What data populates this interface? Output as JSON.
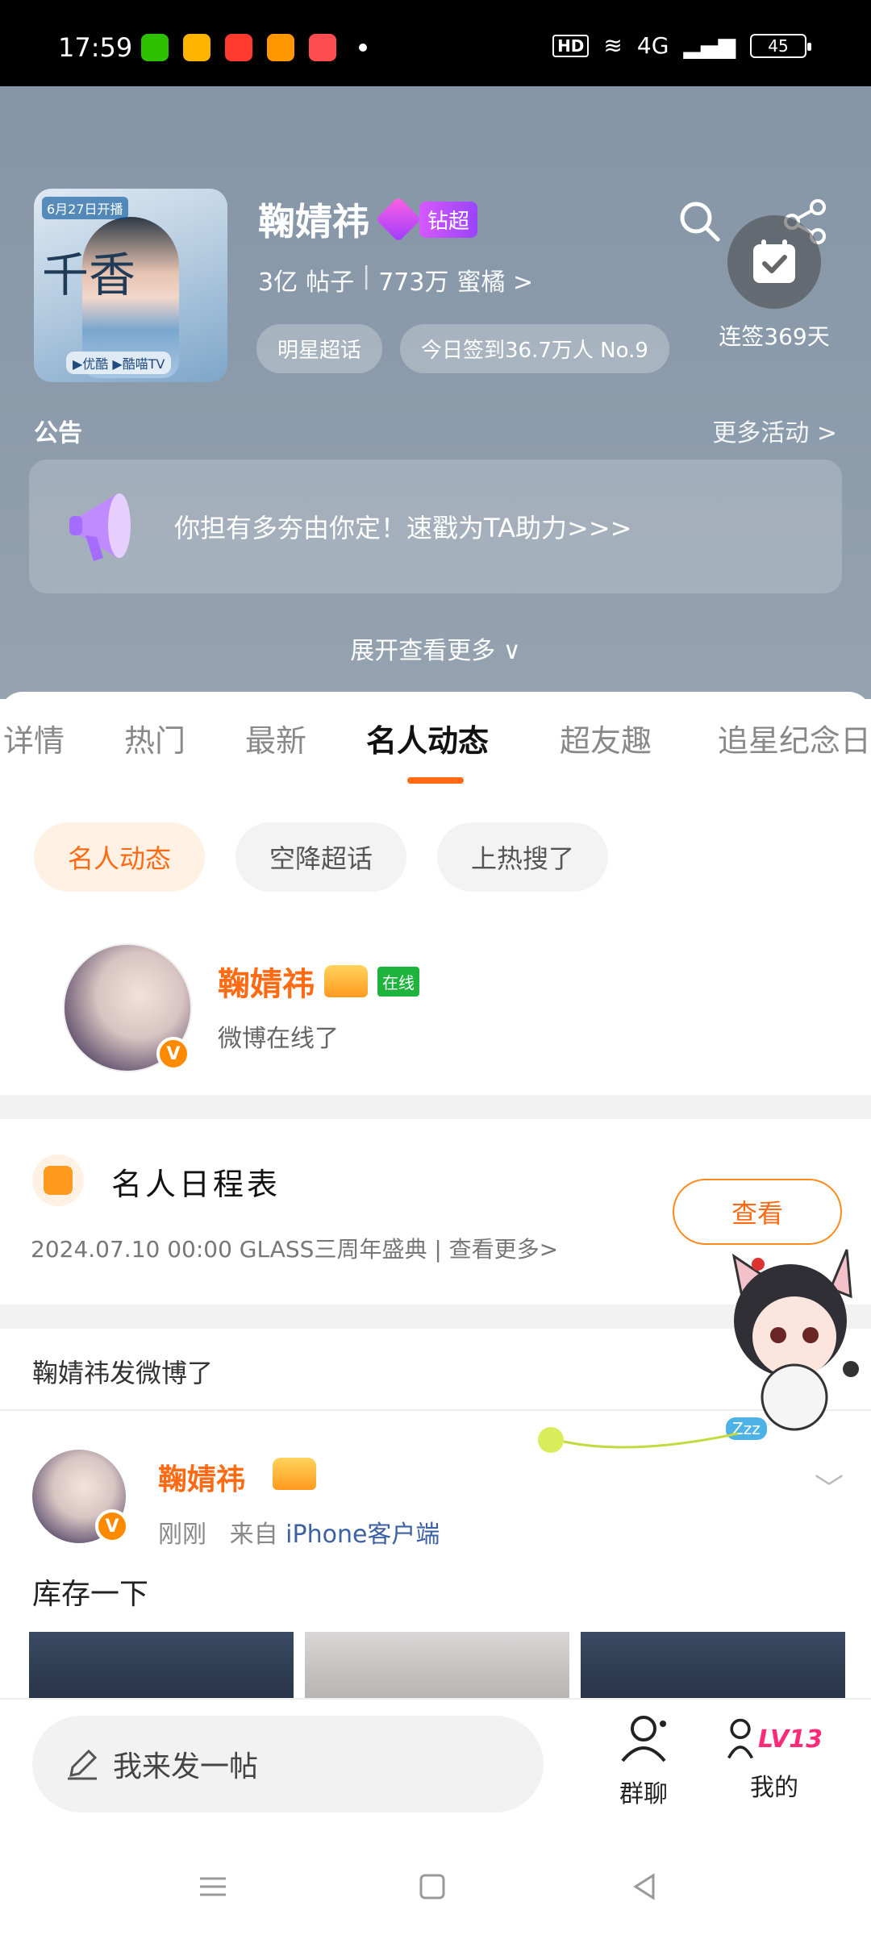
{
  "status_bar": {
    "time": "17:59",
    "hd": "HD",
    "network": "4G",
    "battery": "45"
  },
  "header": {
    "cover": {
      "label": "6月27日开播",
      "big_char": "千香",
      "brand": "▶优酷 ▶酷喵TV"
    },
    "title": "鞠婧祎",
    "super_badge": "钻超",
    "stats": {
      "posts": "3亿",
      "posts_label": "帖子",
      "followers": "773万",
      "followers_label": "蜜橘 >"
    },
    "tags": [
      "明星超话",
      "今日签到36.7万人 No.9"
    ],
    "signin_label": "连签369天",
    "notice_title": "公告",
    "notice_more": "更多活动 >",
    "notice_text": "你担有多夯由你定！速戳为TA助力>>>",
    "expand": "展开查看更多 ∨"
  },
  "tabs": [
    {
      "label": "详情",
      "active": false
    },
    {
      "label": "热门",
      "active": false
    },
    {
      "label": "最新",
      "active": false
    },
    {
      "label": "名人动态",
      "active": true
    },
    {
      "label": "超友趣",
      "active": false
    },
    {
      "label": "追星纪念日",
      "active": false
    }
  ],
  "chips": [
    {
      "label": "名人动态",
      "active": true
    },
    {
      "label": "空降超话",
      "active": false
    },
    {
      "label": "上热搜了",
      "active": false
    }
  ],
  "celebrity": {
    "name": "鞠婧祎",
    "online": "在线",
    "status": "微博在线了",
    "v": "V"
  },
  "schedule": {
    "title": "名人日程表",
    "desc": "2024.07.10 00:00 GLASS三周年盛典 | 查看更多>",
    "button": "查看"
  },
  "posted_notice": "鞠婧祎发微博了",
  "post": {
    "name": "鞠婧祎",
    "time": "刚刚",
    "from": "来自",
    "source": "iPhone客户端",
    "text": "库存一下",
    "v": "V"
  },
  "mascot": {
    "zzz": "Zzz"
  },
  "bottom_bar": {
    "compose_placeholder": "我来发一帖",
    "group_chat": "群聊",
    "mine": "我的",
    "level": "LV13"
  }
}
